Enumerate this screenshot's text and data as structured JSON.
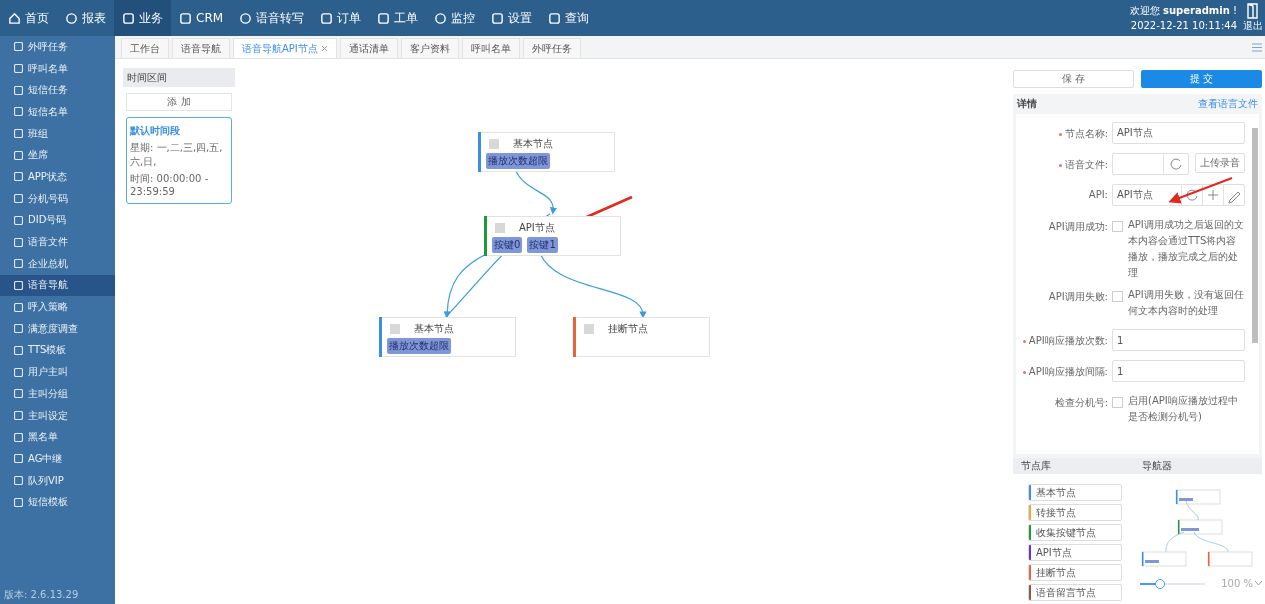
{
  "top_nav": {
    "items": [
      {
        "label": "首页",
        "selected": false
      },
      {
        "label": "报表",
        "selected": false
      },
      {
        "label": "业务",
        "selected": true
      },
      {
        "label": "CRM",
        "selected": false
      },
      {
        "label": "语音转写",
        "selected": false
      },
      {
        "label": "订单",
        "selected": false
      },
      {
        "label": "工单",
        "selected": false
      },
      {
        "label": "监控",
        "selected": false
      },
      {
        "label": "设置",
        "selected": false
      },
      {
        "label": "查询",
        "selected": false
      }
    ],
    "welcome": "欢迎您 **superadmin** !",
    "datetime": "2022-12-21 10:11:44",
    "logout": "退出"
  },
  "sidebar": {
    "items": [
      {
        "label": "外呼任务",
        "selected": false
      },
      {
        "label": "呼叫名单",
        "selected": false
      },
      {
        "label": "短信任务",
        "selected": false
      },
      {
        "label": "短信名单",
        "selected": false
      },
      {
        "label": "班组",
        "selected": false
      },
      {
        "label": "坐席",
        "selected": false
      },
      {
        "label": "APP状态",
        "selected": false
      },
      {
        "label": "分机号码",
        "selected": false
      },
      {
        "label": "DID号码",
        "selected": false
      },
      {
        "label": "语音文件",
        "selected": false
      },
      {
        "label": "企业总机",
        "selected": false
      },
      {
        "label": "语音导航",
        "selected": true
      },
      {
        "label": "呼入策略",
        "selected": false
      },
      {
        "label": "满意度调查",
        "selected": false
      },
      {
        "label": "TTS模板",
        "selected": false
      },
      {
        "label": "用户主叫",
        "selected": false
      },
      {
        "label": "主叫分组",
        "selected": false
      },
      {
        "label": "主叫设定",
        "selected": false
      },
      {
        "label": "黑名单",
        "selected": false
      },
      {
        "label": "AG中继",
        "selected": false
      },
      {
        "label": "队列VIP",
        "selected": false
      },
      {
        "label": "短信模板",
        "selected": false
      }
    ],
    "version": "版本: 2.6.13.29"
  },
  "tabs": [
    {
      "label": "工作台",
      "selected": false,
      "closable": false
    },
    {
      "label": "语音导航",
      "selected": false,
      "closable": false
    },
    {
      "label": "语音导航API节点",
      "selected": true,
      "closable": true
    },
    {
      "label": "通话清单",
      "selected": false,
      "closable": false
    },
    {
      "label": "客户资料",
      "selected": false,
      "closable": false
    },
    {
      "label": "呼叫名单",
      "selected": false,
      "closable": false
    },
    {
      "label": "外呼任务",
      "selected": false,
      "closable": false
    }
  ],
  "time_panel": {
    "title": "时间区间",
    "add_button": "添 加",
    "periods": [
      {
        "name": "默认时间段",
        "days": "星期: 一,二,三,四,五,六,日,",
        "time": "时间: 00:00:00 - 23:59:59",
        "selected": true
      }
    ]
  },
  "canvas": {
    "nodes": [
      {
        "title": "基本节点",
        "color": "#3a8ee6",
        "ports": [
          "播放次数超限"
        ]
      },
      {
        "title": "API节点",
        "color": "#1f9a3a",
        "ports": [
          "按键0",
          "按键1"
        ]
      },
      {
        "title": "基本节点",
        "color": "#3a8ee6",
        "ports": [
          "播放次数超限"
        ]
      },
      {
        "title": "挂断节点",
        "color": "#e8643c"
      }
    ]
  },
  "detail": {
    "save": "保 存",
    "submit": "提 交",
    "title": "详情",
    "link": "查看语言文件",
    "fields": [
      {
        "kind": "input",
        "label": "节点名称:",
        "required": true,
        "value": "API节点"
      },
      {
        "kind": "file",
        "label": "语音文件:",
        "required": true,
        "button": "上传录音"
      },
      {
        "kind": "api",
        "label": "API:",
        "required": false,
        "value": "API节点"
      },
      {
        "kind": "checkbox",
        "label": "API调用成功:",
        "required": false,
        "checked": false,
        "text": "API调用成功之后返回的文本内容会通过TTS将内容播放，播放完成之后的处理"
      },
      {
        "kind": "checkbox",
        "label": "API调用失败:",
        "required": false,
        "checked": false,
        "text": "API调用失败，没有返回任何文本内容时的处理"
      },
      {
        "kind": "input",
        "label": "API响应播放次数:",
        "required": true,
        "value": "1"
      },
      {
        "kind": "input",
        "label": "API响应播放间隔:",
        "required": true,
        "value": "1"
      },
      {
        "kind": "checkbox",
        "label": "检查分机号:",
        "required": false,
        "checked": false,
        "text": "启用(API响应播放过程中是否检测分机号)"
      }
    ]
  },
  "library": {
    "title": "节点库",
    "items": [
      {
        "label": "基本节点",
        "color": "#3a8ee6"
      },
      {
        "label": "转接节点",
        "color": "#f0a534"
      },
      {
        "label": "收集按键节点",
        "color": "#1f9a3a"
      },
      {
        "label": "API节点",
        "color": "#7a2bd6"
      },
      {
        "label": "挂断节点",
        "color": "#e8643c"
      },
      {
        "label": "语音留言节点",
        "color": "#8a5a4a"
      }
    ]
  },
  "navigator": {
    "title": "导航器",
    "level": 0.3,
    "zoom": "100 %"
  }
}
